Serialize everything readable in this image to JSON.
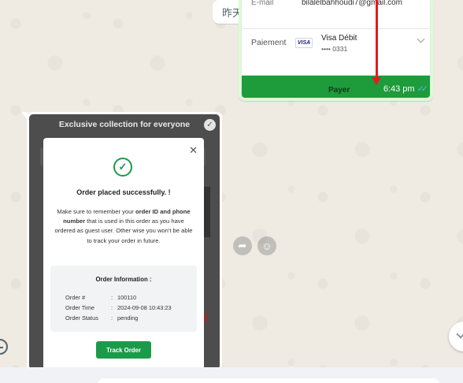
{
  "chat": {
    "date_chip": "昨天"
  },
  "outgoing_image": {
    "email_label": "E-mail",
    "email_value": "bilalelbahhoudi7@gmail.com",
    "payment_label": "Paiement",
    "card_brand": "VISA",
    "card_title": "Visa Débit",
    "card_digits": "•••• 0331",
    "pay_button": "Payer",
    "time": "6:43 pm",
    "ticks": "✓✓",
    "arrow_color": "#e21c1c"
  },
  "incoming_image": {
    "header": "Exclusive collection for everyone",
    "modal": {
      "close": "✕",
      "title": "Order placed successfully. !",
      "msg_1": "Make sure to remember your ",
      "msg_bold": "order ID and phone number",
      "msg_2": " that is used in this order as you have ordered as guest user. Other wise you won't be able to track your order in future.",
      "info_title": "Order Information :",
      "rows": [
        {
          "key": "Order #",
          "value": "100110"
        },
        {
          "key": "Order Time",
          "value": "2024-09-08 10:43:23"
        },
        {
          "key": "Order Status",
          "value": "pending"
        }
      ],
      "track_button": "Track Order"
    }
  },
  "icons": {
    "forward": "forward-icon",
    "emoji": "emoji-icon",
    "scroll_down": "chevron-down-icon",
    "clock": "clock-icon",
    "success": "check-circle-icon"
  },
  "colors": {
    "chat_bg": "#efeae2",
    "outgoing_bubble": "#d9fdd3",
    "success_green": "#1a9b4a",
    "read_ticks": "#53bdeb"
  }
}
